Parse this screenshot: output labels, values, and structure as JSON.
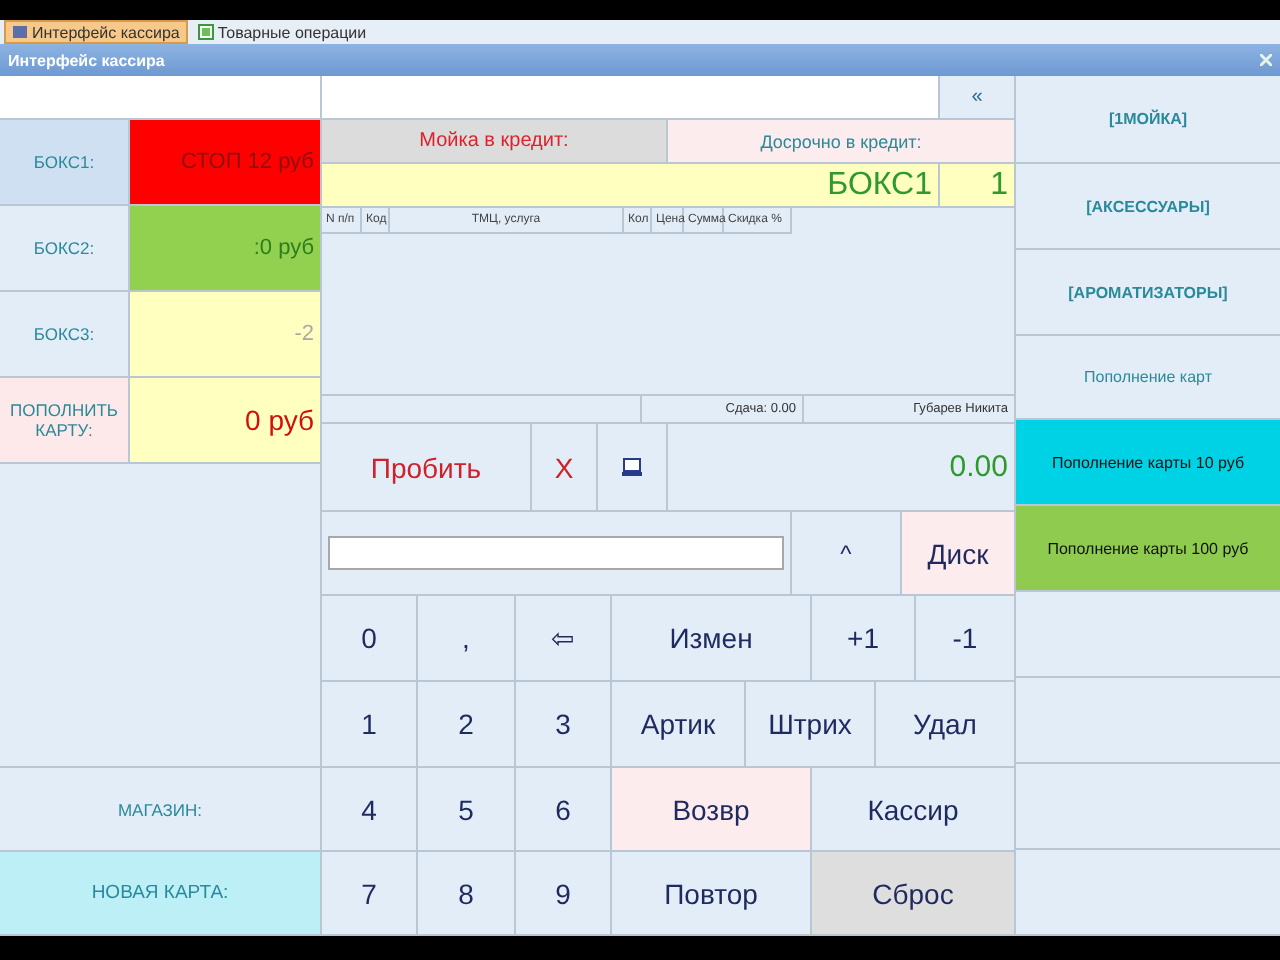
{
  "tabs": [
    {
      "label": "Интерфейс кассира",
      "selected": true
    },
    {
      "label": "Товарные операции",
      "selected": false
    }
  ],
  "window": {
    "title": "Интерфейс кассира"
  },
  "boxes": [
    {
      "label": "БОКС1:",
      "value": "СТОП 12 руб",
      "kind": "stop",
      "selected": true
    },
    {
      "label": "БОКС2:",
      "value": ":0 руб",
      "kind": "active",
      "selected": false
    },
    {
      "label": "БОКС3:",
      "value": "-2",
      "kind": "idle",
      "selected": false
    }
  ],
  "topup": {
    "label": "ПОПОЛНИТЬ КАРТУ:",
    "value": "0 руб"
  },
  "store": {
    "label": "МАГАЗИН:"
  },
  "new_card": {
    "label": "НОВАЯ КАРТА:"
  },
  "collapse_button": "«",
  "credit": {
    "wash": "Мойка в кредит:",
    "early": "Досрочно в кредит:"
  },
  "current": {
    "box": "БОКС1",
    "count": "1"
  },
  "table": {
    "columns": [
      "N п/п",
      "Код",
      "ТМЦ, услуга",
      "Кол",
      "Цена",
      "Сумма",
      "Скидка %"
    ]
  },
  "status_bar": {
    "change": "Сдача: 0.00",
    "cashier": "Губарев Никита"
  },
  "actions": {
    "post": "Пробить",
    "cancel": "X"
  },
  "total": "0.00",
  "input_row": {
    "up": "^",
    "discount": "Диск"
  },
  "keypad": [
    [
      {
        "label": "0",
        "kind": "plain"
      },
      {
        "label": ",",
        "kind": "plain"
      },
      {
        "label": "⇦",
        "kind": "plain"
      },
      {
        "label": "Измен",
        "kind": "plain"
      },
      {
        "label": "+1",
        "kind": "plain"
      },
      {
        "label": "-1",
        "kind": "plain"
      }
    ],
    [
      {
        "label": "1",
        "kind": "plain"
      },
      {
        "label": "2",
        "kind": "plain"
      },
      {
        "label": "3",
        "kind": "plain"
      },
      {
        "label": "Артик",
        "kind": "plain"
      },
      {
        "label": "Штрих",
        "kind": "plain"
      },
      {
        "label": "Удал",
        "kind": "plain"
      }
    ],
    [
      {
        "label": "4",
        "kind": "plain"
      },
      {
        "label": "5",
        "kind": "plain"
      },
      {
        "label": "6",
        "kind": "plain"
      },
      {
        "label": "Возвр",
        "kind": "pink"
      },
      {
        "label": "Кассир",
        "kind": "plain"
      }
    ],
    [
      {
        "label": "7",
        "kind": "plain"
      },
      {
        "label": "8",
        "kind": "plain"
      },
      {
        "label": "9",
        "kind": "plain"
      },
      {
        "label": "Повтор",
        "kind": "plain"
      },
      {
        "label": "Сброс",
        "kind": "gray"
      }
    ]
  ],
  "menu": [
    {
      "label": "[1МОЙКА]",
      "kind": "category"
    },
    {
      "label": "[АКСЕССУАРЫ]",
      "kind": "category"
    },
    {
      "label": "[АРОМАТИЗАТОРЫ]",
      "kind": "category"
    },
    {
      "label": "Пополнение карт",
      "kind": "section"
    },
    {
      "label": "Пополнение карты 10 руб",
      "kind": "tile",
      "color": "#00d2e6"
    },
    {
      "label": "Пополнение карты 100 руб",
      "kind": "tile",
      "color": "#8fcb4f"
    }
  ]
}
